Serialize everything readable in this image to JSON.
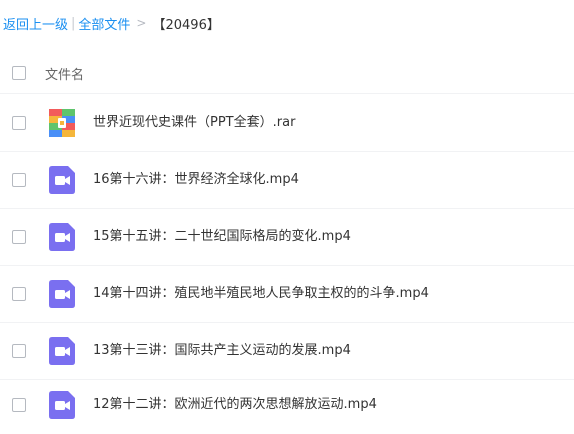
{
  "breadcrumb": {
    "back_label": "返回上一级",
    "separator_bar": "|",
    "all_files_label": "全部文件",
    "separator_arrow": ">",
    "current_folder": "【20496】"
  },
  "list_header": {
    "name_column": "文件名"
  },
  "files": [
    {
      "name": "世界近现代史课件（PPT全套）.rar",
      "icon": "archive-icon"
    },
    {
      "name": "16第十六讲：世界经济全球化.mp4",
      "icon": "video-icon"
    },
    {
      "name": "15第十五讲：二十世纪国际格局的变化.mp4",
      "icon": "video-icon"
    },
    {
      "name": "14第十四讲：殖民地半殖民地人民争取主权的的斗争.mp4",
      "icon": "video-icon"
    },
    {
      "name": "13第十三讲：国际共产主义运动的发展.mp4",
      "icon": "video-icon"
    },
    {
      "name": "12第十二讲：欧洲近代的两次思想解放运动.mp4",
      "icon": "video-icon"
    }
  ],
  "colors": {
    "link": "#1a8ff1",
    "video_icon": "#7a6ff0",
    "text": "#333333"
  }
}
